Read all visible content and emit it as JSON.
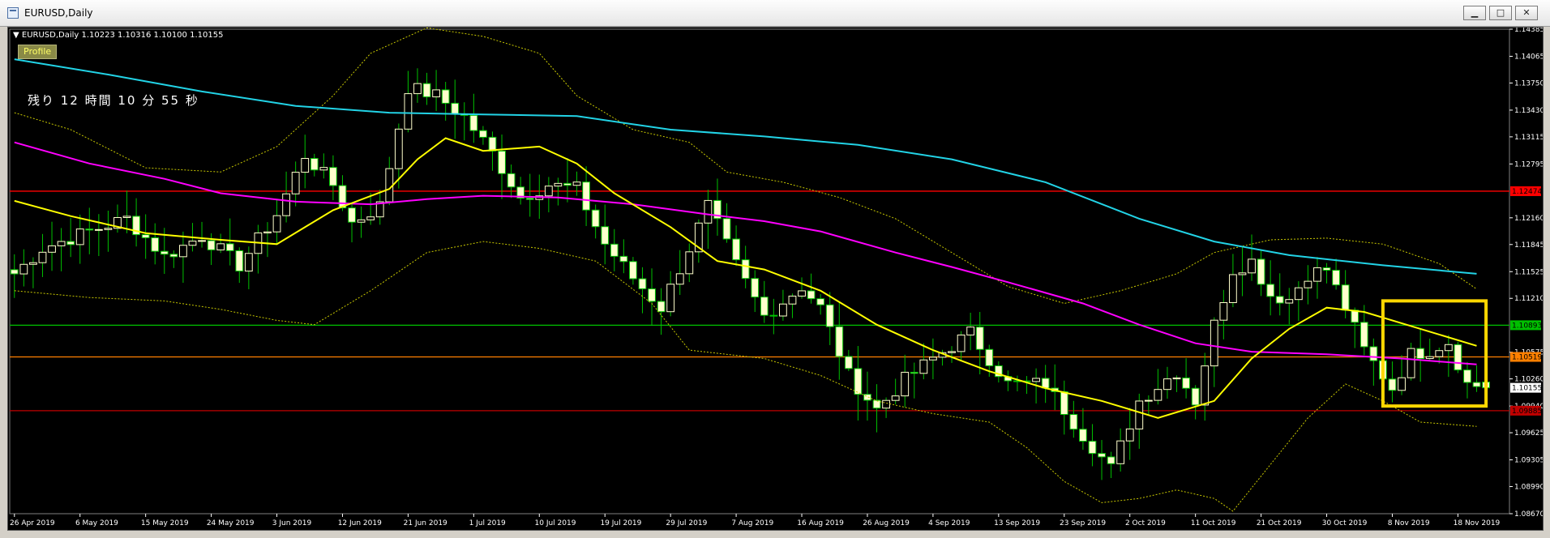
{
  "window": {
    "title": "EURUSD,Daily",
    "btn_min": "▁",
    "btn_max": "□",
    "btn_close": "✕"
  },
  "chart_header": {
    "symbol_info": "EURUSD,Daily  1.10223 1.10316 1.10100 1.10155",
    "profile_label": "Profile",
    "countdown": "残り 12 時間 10 分 55 秒"
  },
  "colors": {
    "background": "#000000",
    "bull_candle": "#ffffcc",
    "bear_candle": "#ffffcc",
    "wick": "#00c000",
    "ma_short": "#ffff00",
    "ma_mid": "#ff00ff",
    "ma_long": "#22d3e6",
    "bollinger": "#c8c800",
    "resistance_line": "#ff0000",
    "pivot_line": "#00c000",
    "mid_line": "#ff8000",
    "support_line": "#c00000",
    "highlight_box": "#ffd700",
    "axis_text": "#ffffff"
  },
  "chart_data": {
    "type": "candlestick",
    "symbol": "EURUSD",
    "timeframe": "Daily",
    "last_ohlc": {
      "open": 1.10223,
      "high": 1.10316,
      "low": 1.101,
      "close": 1.10155
    },
    "ylim": [
      1.0867,
      1.14385
    ],
    "y_ticks": [
      "1.14385",
      "1.14065",
      "1.13750",
      "1.13430",
      "1.13115",
      "1.12795",
      "1.12160",
      "1.11845",
      "1.11525",
      "1.11210",
      "1.10575",
      "1.10260",
      "1.09940",
      "1.09625",
      "1.09305",
      "1.08990",
      "1.08670"
    ],
    "x_labels": [
      "26 Apr 2019",
      "6 May 2019",
      "15 May 2019",
      "24 May 2019",
      "3 Jun 2019",
      "12 Jun 2019",
      "21 Jun 2019",
      "1 Jul 2019",
      "10 Jul 2019",
      "19 Jul 2019",
      "29 Jul 2019",
      "7 Aug 2019",
      "16 Aug 2019",
      "26 Aug 2019",
      "4 Sep 2019",
      "13 Sep 2019",
      "23 Sep 2019",
      "2 Oct 2019",
      "11 Oct 2019",
      "21 Oct 2019",
      "30 Oct 2019",
      "8 Nov 2019",
      "18 Nov 2019"
    ],
    "x_label_positions": [
      0,
      7,
      14,
      21,
      28,
      35,
      42,
      49,
      56,
      63,
      70,
      77,
      84,
      91,
      98,
      105,
      112,
      119,
      126,
      133,
      140,
      147,
      154
    ],
    "bar_count": 158,
    "horizontal_lines": [
      {
        "name": "resistance",
        "price": 1.12474,
        "label": "1.12474",
        "color": "#ff0000"
      },
      {
        "name": "pivot",
        "price": 1.10893,
        "label": "1.10893",
        "color": "#00c000"
      },
      {
        "name": "mid",
        "price": 1.10519,
        "label": "1.10519",
        "color": "#ff8000"
      },
      {
        "name": "support",
        "price": 1.09885,
        "label": "1.09885",
        "color": "#c00000"
      }
    ],
    "current_price": {
      "price": 1.10155,
      "label": "1.10155"
    },
    "highlight_box": {
      "from_bar": 147,
      "to_bar": 156,
      "price_high": 1.1118,
      "price_low": 1.0994
    },
    "ma_short": [
      [
        0,
        1.1236
      ],
      [
        6,
        1.1218
      ],
      [
        14,
        1.1198
      ],
      [
        22,
        1.119
      ],
      [
        28,
        1.1185
      ],
      [
        34,
        1.1225
      ],
      [
        40,
        1.125
      ],
      [
        43,
        1.1285
      ],
      [
        46,
        1.131
      ],
      [
        50,
        1.1295
      ],
      [
        56,
        1.13
      ],
      [
        60,
        1.128
      ],
      [
        64,
        1.1245
      ],
      [
        70,
        1.1205
      ],
      [
        75,
        1.1165
      ],
      [
        80,
        1.1155
      ],
      [
        86,
        1.113
      ],
      [
        92,
        1.109
      ],
      [
        98,
        1.106
      ],
      [
        104,
        1.1035
      ],
      [
        110,
        1.1015
      ],
      [
        116,
        1.1
      ],
      [
        122,
        1.098
      ],
      [
        128,
        1.1
      ],
      [
        132,
        1.105
      ],
      [
        136,
        1.1085
      ],
      [
        140,
        1.111
      ],
      [
        144,
        1.1105
      ],
      [
        150,
        1.1085
      ],
      [
        156,
        1.1065
      ]
    ],
    "ma_mid": [
      [
        0,
        1.1305
      ],
      [
        8,
        1.128
      ],
      [
        16,
        1.1262
      ],
      [
        22,
        1.1245
      ],
      [
        30,
        1.1235
      ],
      [
        38,
        1.1232
      ],
      [
        44,
        1.1238
      ],
      [
        50,
        1.1242
      ],
      [
        58,
        1.124
      ],
      [
        66,
        1.1232
      ],
      [
        74,
        1.122
      ],
      [
        80,
        1.1212
      ],
      [
        86,
        1.12
      ],
      [
        94,
        1.1175
      ],
      [
        100,
        1.1158
      ],
      [
        106,
        1.114
      ],
      [
        114,
        1.1115
      ],
      [
        120,
        1.109
      ],
      [
        126,
        1.1068
      ],
      [
        132,
        1.1058
      ],
      [
        140,
        1.1055
      ],
      [
        148,
        1.105
      ],
      [
        156,
        1.1043
      ]
    ],
    "ma_long": [
      [
        0,
        1.1403
      ],
      [
        10,
        1.1385
      ],
      [
        20,
        1.1365
      ],
      [
        30,
        1.1348
      ],
      [
        40,
        1.134
      ],
      [
        50,
        1.1338
      ],
      [
        60,
        1.1336
      ],
      [
        70,
        1.132
      ],
      [
        80,
        1.1312
      ],
      [
        90,
        1.1302
      ],
      [
        100,
        1.1285
      ],
      [
        110,
        1.1258
      ],
      [
        120,
        1.1215
      ],
      [
        128,
        1.1188
      ],
      [
        136,
        1.1172
      ],
      [
        146,
        1.116
      ],
      [
        156,
        1.115
      ]
    ],
    "bollinger_upper": [
      [
        0,
        1.134
      ],
      [
        6,
        1.132
      ],
      [
        14,
        1.1275
      ],
      [
        22,
        1.127
      ],
      [
        28,
        1.13
      ],
      [
        34,
        1.136
      ],
      [
        38,
        1.141
      ],
      [
        44,
        1.144
      ],
      [
        50,
        1.143
      ],
      [
        56,
        1.141
      ],
      [
        60,
        1.136
      ],
      [
        66,
        1.132
      ],
      [
        72,
        1.1305
      ],
      [
        76,
        1.127
      ],
      [
        82,
        1.1258
      ],
      [
        88,
        1.124
      ],
      [
        94,
        1.1215
      ],
      [
        100,
        1.1175
      ],
      [
        106,
        1.1135
      ],
      [
        112,
        1.1115
      ],
      [
        118,
        1.113
      ],
      [
        124,
        1.115
      ],
      [
        128,
        1.1175
      ],
      [
        134,
        1.119
      ],
      [
        140,
        1.1192
      ],
      [
        146,
        1.1185
      ],
      [
        152,
        1.1162
      ],
      [
        156,
        1.1132
      ]
    ],
    "bollinger_lower": [
      [
        0,
        1.113
      ],
      [
        8,
        1.1122
      ],
      [
        16,
        1.1118
      ],
      [
        22,
        1.1108
      ],
      [
        28,
        1.1095
      ],
      [
        32,
        1.109
      ],
      [
        38,
        1.113
      ],
      [
        44,
        1.1175
      ],
      [
        50,
        1.1188
      ],
      [
        56,
        1.118
      ],
      [
        62,
        1.1165
      ],
      [
        68,
        1.1115
      ],
      [
        72,
        1.106
      ],
      [
        80,
        1.105
      ],
      [
        86,
        1.103
      ],
      [
        92,
        1.1
      ],
      [
        98,
        1.0985
      ],
      [
        104,
        1.0975
      ],
      [
        108,
        1.0945
      ],
      [
        112,
        1.0905
      ],
      [
        116,
        1.088
      ],
      [
        120,
        1.0885
      ],
      [
        124,
        1.0895
      ],
      [
        128,
        1.0885
      ],
      [
        130,
        1.087
      ],
      [
        134,
        1.0925
      ],
      [
        138,
        1.098
      ],
      [
        142,
        1.102
      ],
      [
        146,
        1.1
      ],
      [
        150,
        1.0975
      ],
      [
        156,
        1.097
      ]
    ],
    "path_anchors": [
      [
        0,
        1.115
      ],
      [
        3,
        1.118
      ],
      [
        8,
        1.12
      ],
      [
        12,
        1.1215
      ],
      [
        16,
        1.117
      ],
      [
        20,
        1.1195
      ],
      [
        24,
        1.116
      ],
      [
        28,
        1.122
      ],
      [
        31,
        1.129
      ],
      [
        34,
        1.1255
      ],
      [
        36,
        1.121
      ],
      [
        39,
        1.123
      ],
      [
        42,
        1.137
      ],
      [
        45,
        1.136
      ],
      [
        48,
        1.1335
      ],
      [
        51,
        1.1292
      ],
      [
        54,
        1.124
      ],
      [
        57,
        1.1255
      ],
      [
        60,
        1.125
      ],
      [
        63,
        1.1185
      ],
      [
        66,
        1.1145
      ],
      [
        69,
        1.111
      ],
      [
        72,
        1.118
      ],
      [
        74,
        1.123
      ],
      [
        77,
        1.116
      ],
      [
        80,
        1.11
      ],
      [
        84,
        1.1135
      ],
      [
        86,
        1.111
      ],
      [
        89,
        1.103
      ],
      [
        92,
        1.099
      ],
      [
        95,
        1.1025
      ],
      [
        98,
        1.105
      ],
      [
        102,
        1.108
      ],
      [
        106,
        1.102
      ],
      [
        110,
        1.102
      ],
      [
        114,
        1.096
      ],
      [
        117,
        1.092
      ],
      [
        120,
        1.1
      ],
      [
        124,
        1.1035
      ],
      [
        126,
        1.1
      ],
      [
        128,
        1.109
      ],
      [
        130,
        1.1155
      ],
      [
        132,
        1.1165
      ],
      [
        134,
        1.1125
      ],
      [
        136,
        1.112
      ],
      [
        138,
        1.115
      ],
      [
        140,
        1.1155
      ],
      [
        142,
        1.111
      ],
      [
        144,
        1.106
      ],
      [
        147,
        1.1015
      ],
      [
        149,
        1.1055
      ],
      [
        151,
        1.106
      ],
      [
        153,
        1.107
      ],
      [
        155,
        1.102
      ],
      [
        157,
        1.1016
      ]
    ]
  }
}
